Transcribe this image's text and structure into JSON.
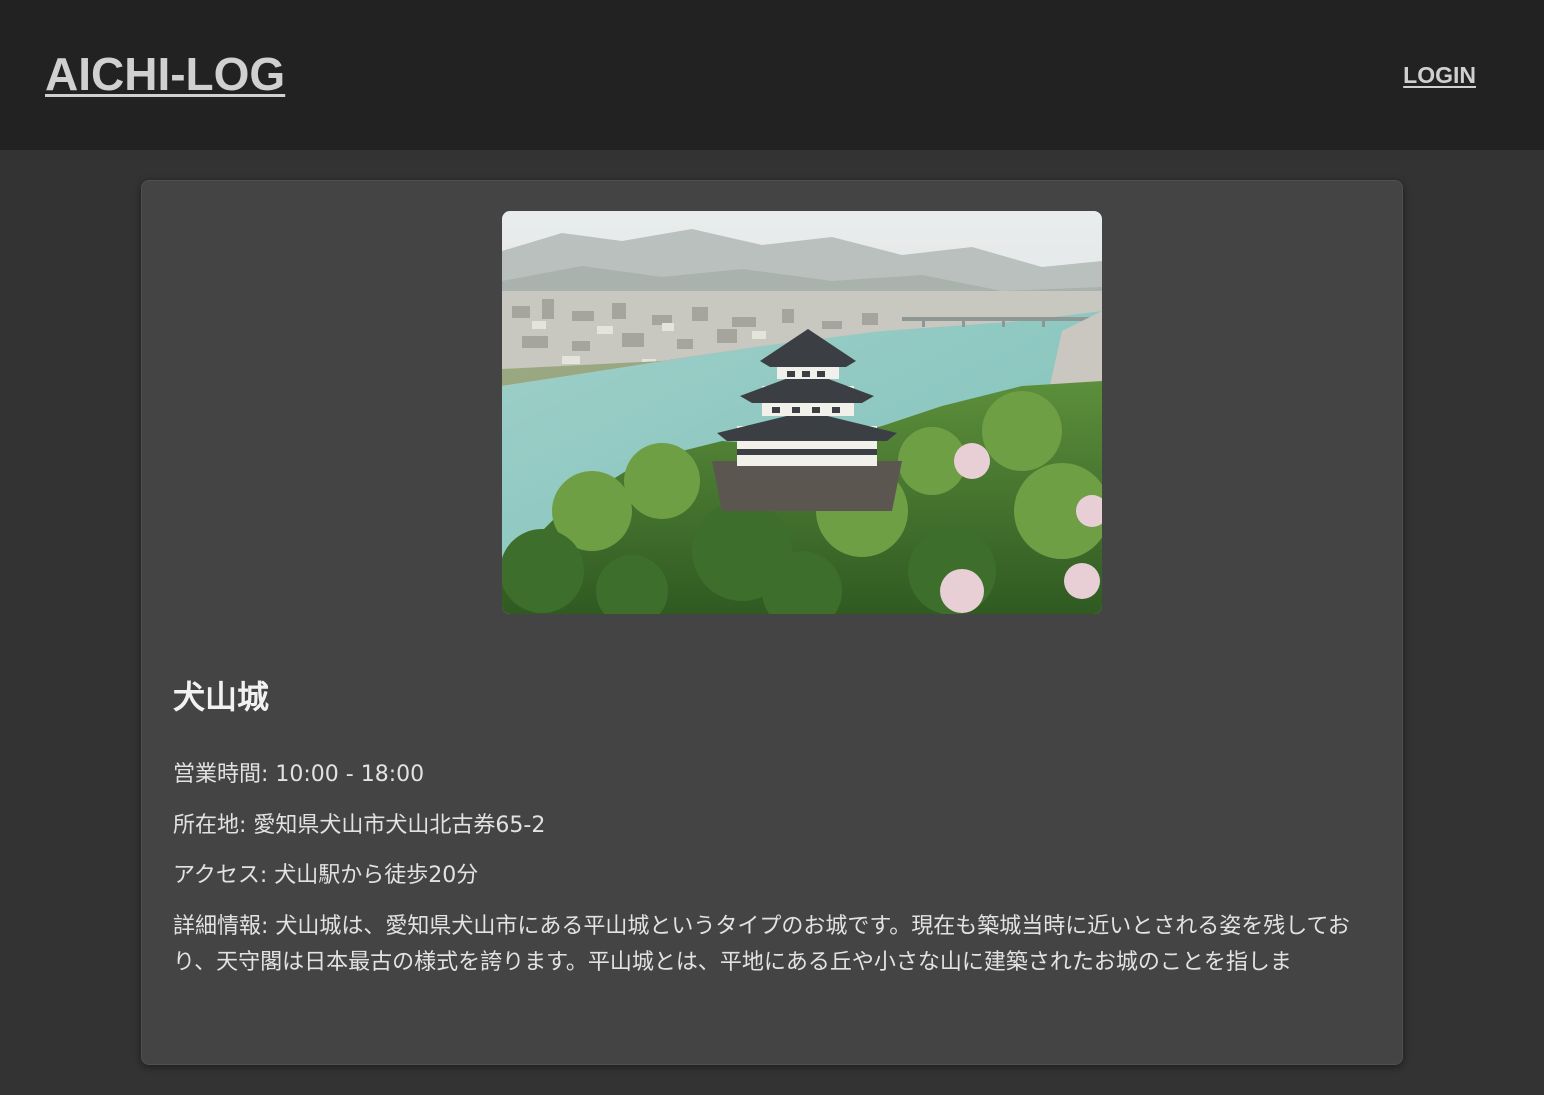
{
  "header": {
    "logo": "AICHI-LOG",
    "login_label": "LOGIN"
  },
  "spot": {
    "name": "犬山城",
    "hours": "営業時間: 10:00 - 18:00",
    "address": "所在地: 愛知県犬山市犬山北古券65-2",
    "access": "アクセス: 犬山駅から徒歩20分",
    "details": "詳細情報: 犬山城は、愛知県犬山市にある平山城というタイプのお城です。現在も築城当時に近いとされる姿を残しており、天守閣は日本最古の様式を誇ります。平山城とは、平地にある丘や小さな山に建築されたお城のことを指しま"
  },
  "colors": {
    "header_bg": "#222222",
    "page_bg": "#333333",
    "card_bg": "#444444",
    "text": "#e2e2e2"
  }
}
